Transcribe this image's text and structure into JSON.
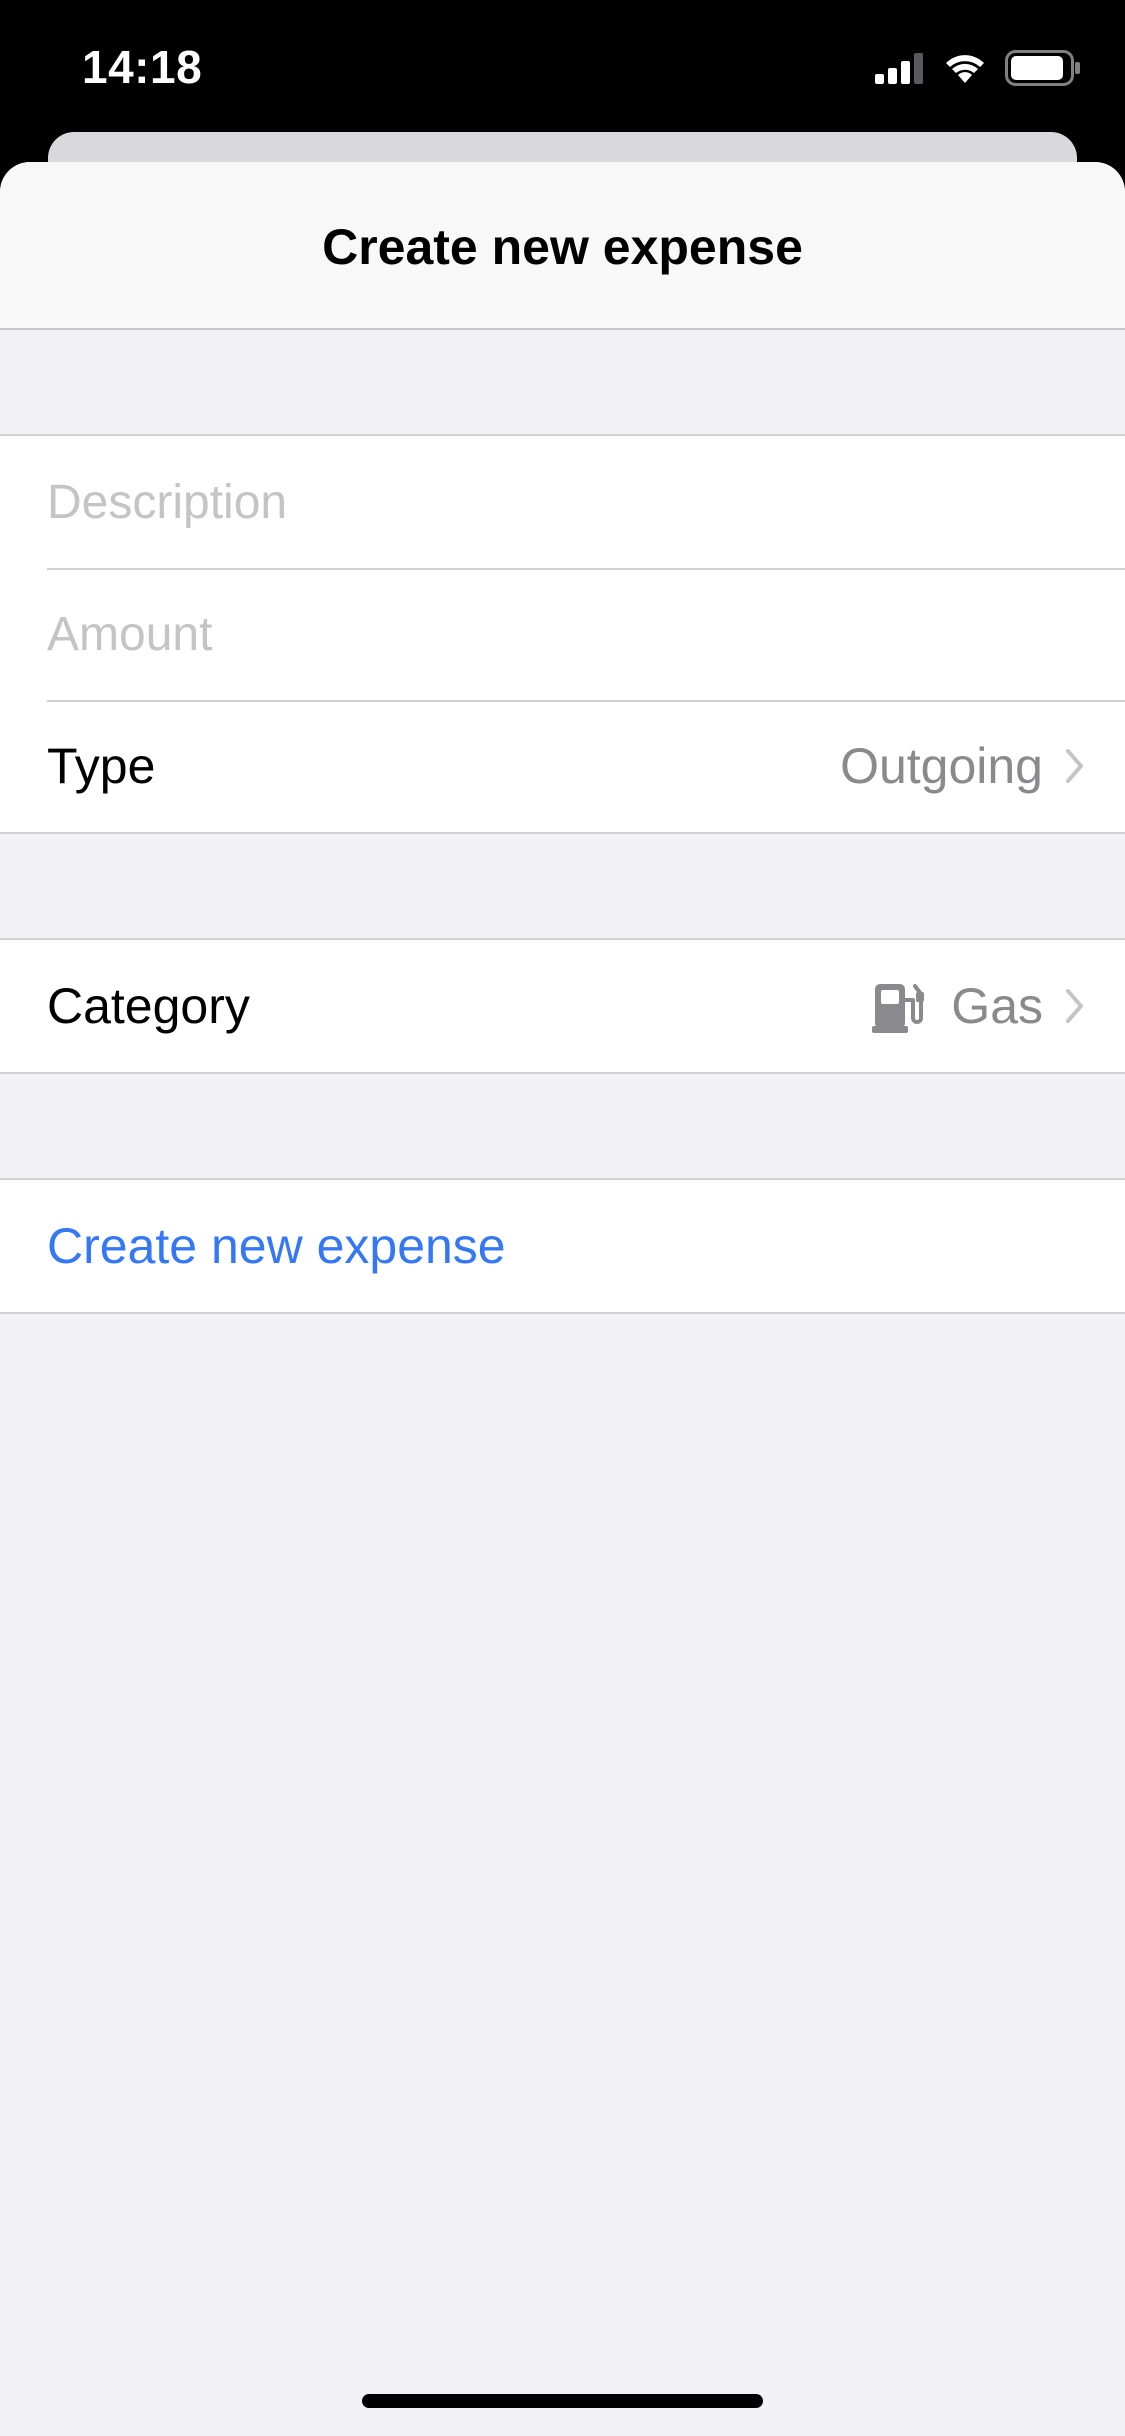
{
  "status_bar": {
    "time": "14:18",
    "icons": [
      "cellular-signal-icon",
      "wifi-icon",
      "battery-icon"
    ]
  },
  "sheet": {
    "title": "Create new expense"
  },
  "form": {
    "description": {
      "placeholder": "Description",
      "value": ""
    },
    "amount": {
      "placeholder": "Amount",
      "value": ""
    },
    "type": {
      "label": "Type",
      "value": "Outgoing"
    },
    "category": {
      "label": "Category",
      "value": "Gas",
      "icon": "gas-pump-icon"
    },
    "submit_label": "Create new expense"
  },
  "colors": {
    "accent": "#3478f6",
    "background": "#f1f1f6",
    "secondary_text": "#8a8a8e",
    "placeholder": "#c4c4c6"
  }
}
